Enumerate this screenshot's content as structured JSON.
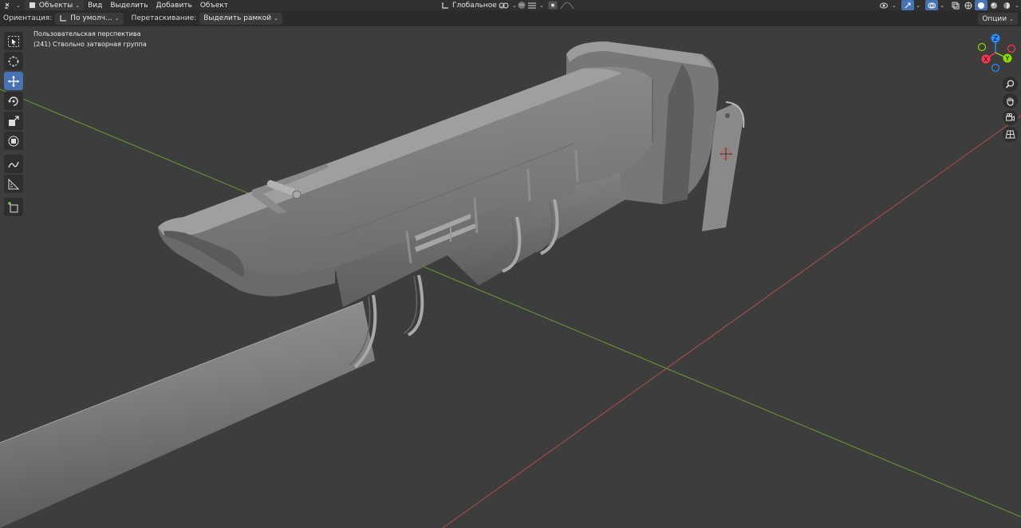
{
  "header": {
    "editor_menu": "Объекты",
    "menus": [
      "Вид",
      "Выделить",
      "Добавить",
      "Объект"
    ],
    "transform_orientation": "Глобальное"
  },
  "tool_settings": {
    "orientation_label": "Ориентация:",
    "orientation_value": "По умолч...",
    "drag_label": "Перетаскивание:",
    "drag_value": "Выделить рамкой",
    "options_label": "Опции"
  },
  "viewport": {
    "view_name": "Пользовательская перспектива",
    "object_info": "(241) Ствольно затворная группа"
  },
  "gizmo": {
    "axes": [
      "X",
      "Y",
      "Z"
    ],
    "colors": {
      "x": "#ff3352",
      "y": "#8bdc00",
      "z": "#2890ff"
    }
  },
  "colors": {
    "accent": "#4772b3",
    "x_axis_line": "#b44b4f",
    "y_axis_line": "#6d9a2f",
    "model_gray": "#8a8a8a"
  },
  "toolbar": {
    "tools": [
      "select-box",
      "cursor",
      "move",
      "rotate",
      "scale",
      "transform",
      "annotate",
      "measure",
      "add-cube"
    ],
    "active_tool": "move"
  }
}
